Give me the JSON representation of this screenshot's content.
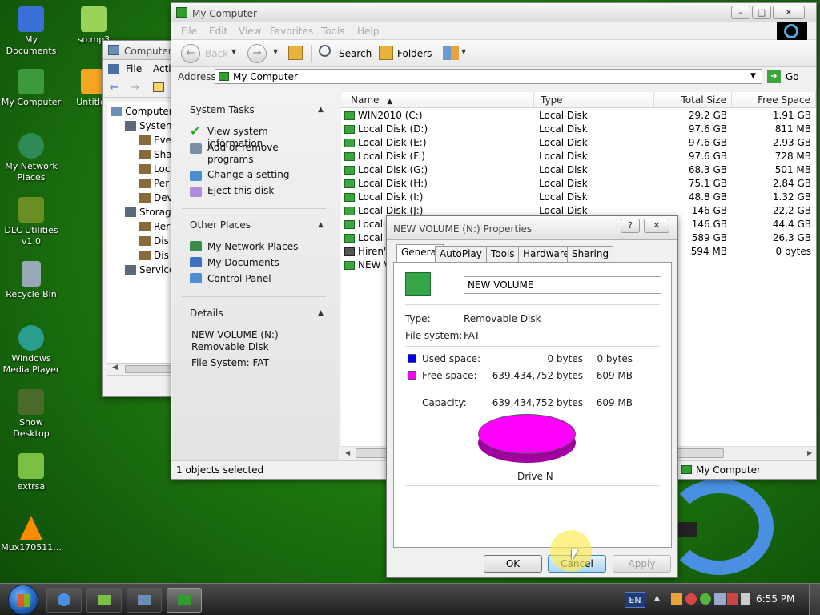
{
  "desktop": {
    "icons": [
      {
        "label": "My Documents",
        "color": "#3a6fd6"
      },
      {
        "label": "so.mp3",
        "color": "#9ad35a"
      },
      {
        "label": "My Computer",
        "color": "#3c9a3c"
      },
      {
        "label": "Untitled",
        "color": "#f5a623"
      },
      {
        "label": "My Network Places",
        "color": "#2e8b57"
      },
      {
        "label": "DLC Utilities v1.0",
        "color": "#6b8e23"
      },
      {
        "label": "Recycle Bin",
        "color": "#9aa9b8"
      },
      {
        "label": "Windows Media Player",
        "color": "#2a9d8f"
      },
      {
        "label": "Show Desktop",
        "color": "#4a6a2a"
      },
      {
        "label": "extrsa",
        "color": "#7bc043"
      },
      {
        "label": "Mux170511...",
        "color": "#ff8c00"
      }
    ]
  },
  "back_window": {
    "title": "Computer",
    "menu": [
      "File",
      "Acti"
    ],
    "tree": [
      {
        "label": "Computer",
        "indent": 0
      },
      {
        "label": "System",
        "indent": 1
      },
      {
        "label": "Eve",
        "indent": 2
      },
      {
        "label": "Sha",
        "indent": 2
      },
      {
        "label": "Loc",
        "indent": 2
      },
      {
        "label": "Per",
        "indent": 2
      },
      {
        "label": "Dev",
        "indent": 2
      },
      {
        "label": "Storag",
        "indent": 1
      },
      {
        "label": "Rer",
        "indent": 2
      },
      {
        "label": "Dis",
        "indent": 2
      },
      {
        "label": "Dis",
        "indent": 2
      },
      {
        "label": "Service",
        "indent": 1
      }
    ]
  },
  "explorer": {
    "title": "My Computer",
    "menu": [
      "File",
      "Edit",
      "View",
      "Favorites",
      "Tools",
      "Help"
    ],
    "toolbar": {
      "back": "Back",
      "search": "Search",
      "folders": "Folders"
    },
    "address": {
      "label": "Address",
      "value": "My Computer",
      "go": "Go"
    },
    "tasks": {
      "system_tasks": {
        "title": "System Tasks",
        "items": [
          "View system information",
          "Add or remove programs",
          "Change a setting",
          "Eject this disk"
        ]
      },
      "other_places": {
        "title": "Other Places",
        "items": [
          "My Network Places",
          "My Documents",
          "Control Panel"
        ]
      },
      "details": {
        "title": "Details",
        "name": "NEW VOLUME (N:)",
        "type": "Removable Disk",
        "fs": "File System: FAT"
      }
    },
    "columns": {
      "name": "Name",
      "type": "Type",
      "total": "Total Size",
      "free": "Free Space"
    },
    "drives": [
      {
        "name": "WIN2010 (C:)",
        "type": "Local Disk",
        "total": "29.2 GB",
        "free": "1.91 GB"
      },
      {
        "name": "Local Disk (D:)",
        "type": "Local Disk",
        "total": "97.6 GB",
        "free": "811 MB"
      },
      {
        "name": "Local Disk (E:)",
        "type": "Local Disk",
        "total": "97.6 GB",
        "free": "2.93 GB"
      },
      {
        "name": "Local Disk (F:)",
        "type": "Local Disk",
        "total": "97.6 GB",
        "free": "728 MB"
      },
      {
        "name": "Local Disk (G:)",
        "type": "Local Disk",
        "total": "68.3 GB",
        "free": "501 MB"
      },
      {
        "name": "Local Disk (H:)",
        "type": "Local Disk",
        "total": "75.1 GB",
        "free": "2.84 GB"
      },
      {
        "name": "Local Disk (I:)",
        "type": "Local Disk",
        "total": "48.8 GB",
        "free": "1.32 GB"
      },
      {
        "name": "Local Disk (J:)",
        "type": "Local Disk",
        "total": "146 GB",
        "free": "22.2 GB"
      },
      {
        "name": "Local",
        "type": "",
        "total": "146 GB",
        "free": "44.4 GB"
      },
      {
        "name": "Local",
        "type": "",
        "total": "589 GB",
        "free": "26.3 GB"
      },
      {
        "name": "Hiren'",
        "type": "",
        "total": "594 MB",
        "free": "0 bytes"
      },
      {
        "name": "NEW V",
        "type": "",
        "total": "",
        "free": ""
      }
    ],
    "status": {
      "selected": "1 objects selected",
      "location": "My Computer"
    }
  },
  "dialog": {
    "title": "NEW VOLUME (N:) Properties",
    "tabs": [
      "General",
      "AutoPlay",
      "Tools",
      "Hardware",
      "Sharing"
    ],
    "volume_name": "NEW VOLUME",
    "type_label": "Type:",
    "type_value": "Removable Disk",
    "fs_label": "File system:",
    "fs_value": "FAT",
    "used_label": "Used space:",
    "used_bytes": "0 bytes",
    "used_size": "0 bytes",
    "free_label": "Free space:",
    "free_bytes": "639,434,752 bytes",
    "free_size": "609 MB",
    "capacity_label": "Capacity:",
    "capacity_bytes": "639,434,752 bytes",
    "capacity_size": "609 MB",
    "drive_label": "Drive N",
    "buttons": {
      "ok": "OK",
      "cancel": "Cancel",
      "apply": "Apply"
    },
    "colors": {
      "used": "#0000ff",
      "free": "#ff00ff"
    }
  },
  "taskbar": {
    "lang": "EN",
    "clock": "6:55 PM"
  }
}
